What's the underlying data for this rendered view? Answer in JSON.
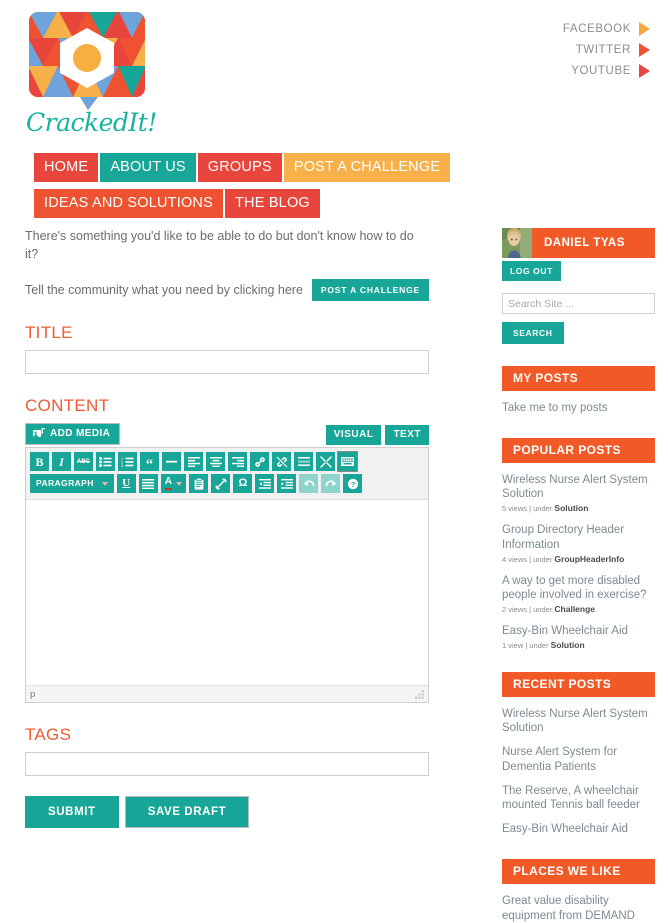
{
  "brand": {
    "logo_text": "CrackedIt!",
    "logo_icon": "mosaic-speech-bubble-logo"
  },
  "social": [
    {
      "label": "FACEBOOK",
      "icon": "play-triangle-icon",
      "color": "#f5a93f"
    },
    {
      "label": "TWITTER",
      "icon": "play-triangle-icon",
      "color": "#ef5230"
    },
    {
      "label": "YOUTUBE",
      "icon": "play-triangle-icon",
      "color": "#e8453c"
    }
  ],
  "nav": [
    {
      "label": "HOME",
      "color": "#e8453c"
    },
    {
      "label": "ABOUT US",
      "color": "#17a697"
    },
    {
      "label": "GROUPS",
      "color": "#e8453c"
    },
    {
      "label": "POST A CHALLENGE",
      "color": "#f7b04a"
    },
    {
      "label": "IDEAS AND SOLUTIONS",
      "color": "#ef5230"
    },
    {
      "label": "THE BLOG",
      "color": "#e8453c"
    }
  ],
  "main": {
    "lead_line1": "There's something you'd like to be able to do but don't know how to do it?",
    "lead_line2": "Tell the community what you need by clicking here",
    "inline_cta": "POST A CHALLENGE",
    "title_label": "TITLE",
    "title_value": "",
    "content_label": "CONTENT",
    "add_media": "ADD MEDIA",
    "tabs": [
      {
        "label": "VISUAL",
        "active": true
      },
      {
        "label": "TEXT",
        "active": false
      }
    ],
    "toolbar_row1": [
      {
        "name": "bold-icon",
        "glyph": "B"
      },
      {
        "name": "italic-icon",
        "glyph": "I"
      },
      {
        "name": "strikethrough-icon",
        "glyph": "ABC"
      },
      {
        "name": "bullet-list-icon",
        "glyph": ""
      },
      {
        "name": "numbered-list-icon",
        "glyph": ""
      },
      {
        "name": "blockquote-icon",
        "glyph": "“"
      },
      {
        "name": "horizontal-rule-icon",
        "glyph": "—"
      },
      {
        "name": "align-left-icon",
        "glyph": ""
      },
      {
        "name": "align-center-icon",
        "glyph": ""
      },
      {
        "name": "align-right-icon",
        "glyph": ""
      },
      {
        "name": "insert-link-icon",
        "glyph": ""
      },
      {
        "name": "unlink-icon",
        "glyph": ""
      },
      {
        "name": "read-more-tag-icon",
        "glyph": ""
      },
      {
        "name": "fullscreen-icon",
        "glyph": ""
      },
      {
        "name": "toggle-toolbar-icon",
        "glyph": "",
        "selected": true
      }
    ],
    "toolbar_row2": [
      {
        "name": "paragraph-format-select",
        "glyph": "PARAGRAPH"
      },
      {
        "name": "underline-icon",
        "glyph": "U"
      },
      {
        "name": "justify-icon",
        "glyph": ""
      },
      {
        "name": "text-color-icon",
        "glyph": "A"
      },
      {
        "name": "paste-as-text-icon",
        "glyph": ""
      },
      {
        "name": "clear-formatting-icon",
        "glyph": ""
      },
      {
        "name": "special-character-icon",
        "glyph": "Ω"
      },
      {
        "name": "outdent-icon",
        "glyph": ""
      },
      {
        "name": "indent-icon",
        "glyph": ""
      },
      {
        "name": "undo-icon",
        "glyph": "",
        "dim": true
      },
      {
        "name": "redo-icon",
        "glyph": "",
        "dim": true
      },
      {
        "name": "keyboard-shortcuts-help-icon",
        "glyph": "?"
      }
    ],
    "editor_value": "",
    "editor_path": "p",
    "tags_label": "TAGS",
    "tags_value": "",
    "submit_label": "SUBMIT",
    "save_draft_label": "SAVE DRAFT"
  },
  "sidebar": {
    "user": {
      "name": "DANIEL TYAS",
      "avatar": "user-avatar-photo",
      "logout_label": "LOG OUT"
    },
    "search": {
      "placeholder": "Search Site ...",
      "value": "",
      "button_label": "SEARCH"
    },
    "my_posts": {
      "heading": "MY POSTS",
      "link": "Take me to my posts"
    },
    "popular_posts": {
      "heading": "POPULAR POSTS",
      "items": [
        {
          "title": "Wireless Nurse Alert System Solution",
          "views": "5 views",
          "separator": " | under ",
          "category": "Solution"
        },
        {
          "title": "Group Directory Header Information",
          "views": "4 views",
          "separator": " | under ",
          "category": "GroupHeaderInfo"
        },
        {
          "title": "A way to get more disabled people involved in exercise?",
          "views": "2 views",
          "separator": " | under ",
          "category": "Challenge"
        },
        {
          "title": "Easy-Bin Wheelchair Aid",
          "views": "1 view",
          "separator": " | under ",
          "category": "Solution"
        }
      ]
    },
    "recent_posts": {
      "heading": "RECENT POSTS",
      "items": [
        {
          "title": "Wireless Nurse Alert System Solution"
        },
        {
          "title": "Nurse Alert System for Dementia Patients"
        },
        {
          "title": "The Reserve, A wheelchair mounted Tennis ball feeder"
        },
        {
          "title": "Easy-Bin Wheelchair Aid"
        }
      ]
    },
    "places_we_like": {
      "heading": "PLACES WE LIKE",
      "items": [
        {
          "title": "Great value disability equipment from DEMAND"
        }
      ]
    }
  },
  "colors": {
    "red": "#e8453c",
    "teal": "#17a697",
    "amber": "#f7b04a",
    "orange": "#f15a27",
    "orange_red": "#ef5230",
    "label_orange": "#f05a32"
  }
}
